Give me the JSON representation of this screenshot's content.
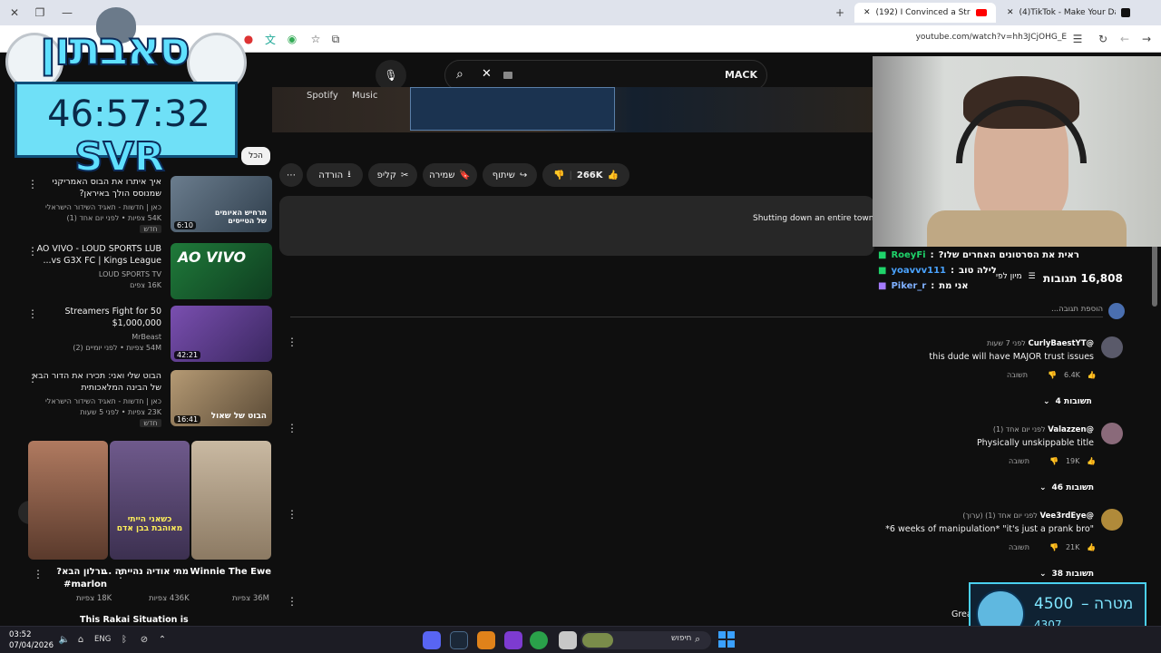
{
  "browser": {
    "tabs": [
      {
        "title": "(192) I Convinced a Stranger to",
        "active": true
      },
      {
        "title": "(4)TikTok - Make Your Day",
        "active": false
      }
    ],
    "url": "youtube.com/watch?v=hh3JCjOHG_E"
  },
  "youtube": {
    "search_query": "MACK",
    "banner_brands": [
      "Spotify",
      "Music"
    ],
    "chip_all": "הכל",
    "actions": {
      "likes": "266K",
      "share": "שיתוף",
      "save": "שמירה",
      "clip": "קליפ",
      "download": "הורדה"
    },
    "description_snippet": "Shutting down an entire town wa",
    "related": [
      {
        "title": "איך איתרו את הבוס האמריקני שמנוסס הולך באיראן?",
        "channel": "כאן | חדשות - תאגיד השידור הישראלי",
        "meta": "54K צפיות • לפני יום אחד (1)",
        "badge": "חדש",
        "duration": "6:10",
        "thumb_text": "תרחיש האיומים של הטייסים"
      },
      {
        "title": "AO VIVO - LOUD SPORTS LUB vs G3X FC | Kings League...",
        "channel": "LOUD SPORTS TV",
        "meta": "16K צפים",
        "badge": "",
        "duration": "",
        "thumb_text": "AO VIVO"
      },
      {
        "title": "50 Streamers Fight for $1,000,000",
        "channel": "MrBeast",
        "meta": "54M צפיות • לפני יומיים (2)",
        "badge": "",
        "duration": "42:21",
        "thumb_text": ""
      },
      {
        "title": "הבוט שלי ואני: תכירו את הדור הבא של הבינה המלאכותית",
        "channel": "כאן | חדשות - תאגיד השידור הישראלי",
        "meta": "23K צפיות • לפני 5 שעות",
        "badge": "חדש",
        "duration": "16:41",
        "thumb_text": "הבוט של שאול"
      }
    ],
    "shorts": [
      {
        "title": "Winnie The Ewe",
        "views": "36M צפיות"
      },
      {
        "title": "מתי אודיה נהייתה ...",
        "views": "436K צפיות",
        "thumb_text": "כשאני הייתי מאוהבת בבן אדם"
      },
      {
        "title": "מרלון הבא? marlon#",
        "views": "18K צפיות"
      }
    ],
    "bottom_related_title": "This Rakai Situation is",
    "comments": {
      "count_label": "16,808 תגובות",
      "sort_label": "מיון לפי",
      "add_placeholder": "הוספת תגובה...",
      "items": [
        {
          "author": "@CurlyBaestYT",
          "time": "לפני 7 שעות",
          "text": "this dude will have MAJOR trust issues",
          "likes": "6.4K",
          "reply": "תשובה",
          "replies": "4 תשובות"
        },
        {
          "author": "@Valazzen",
          "time": "לפני יום אחד (1)",
          "text": "Physically unskippable title",
          "likes": "19K",
          "reply": "תשובה",
          "replies": "46 תשובות"
        },
        {
          "author": "@Vee3rdEye",
          "time": "לפני יום אחד (1) (ערוך)",
          "text": "*6 weeks of manipulation* \"it's just a prank bro\"",
          "likes": "21K",
          "reply": "תשובה",
          "replies": "38 תשובות"
        }
      ],
      "trailing": "Grea"
    }
  },
  "stream_overlay": {
    "brand": "סאבתון",
    "timer": "46:57:32",
    "tag": "SVR",
    "chat": [
      {
        "user": "RoeyFi",
        "message": "ראית את הסרטונים האחרים שלו?",
        "color": "#1fd36a"
      },
      {
        "user": "yoavvv111",
        "message": "לילה טוב",
        "color": "#4aa3ff"
      },
      {
        "user": "Piker_r",
        "message": "אני מת",
        "color": "#7fb0ff"
      }
    ],
    "goal": {
      "label": "מטרה",
      "target": "4500",
      "current": "4307"
    }
  },
  "taskbar": {
    "time": "03:52",
    "date": "07/04/2026",
    "lang": "ENG",
    "search_label": "חיפוש"
  }
}
